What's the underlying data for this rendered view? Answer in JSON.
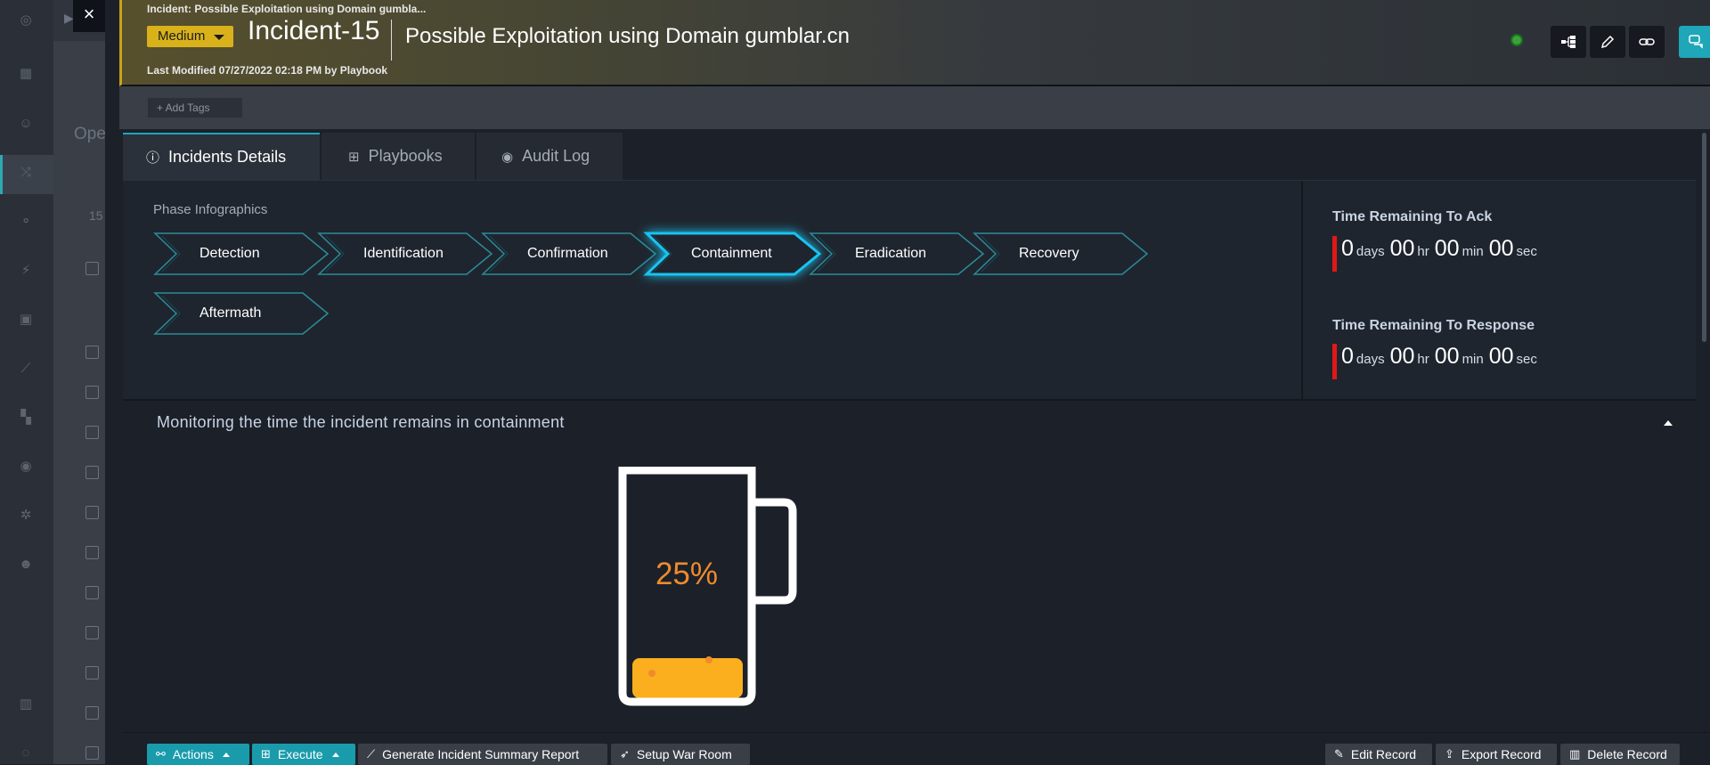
{
  "header": {
    "breadcrumb": "Incident: Possible Exploitation using Domain gumbla...",
    "severity": "Medium",
    "incident_id": "Incident-15",
    "incident_title": "Possible Exploitation using Domain gumblar.cn",
    "last_modified": "Last Modified 07/27/2022 02:18 PM by Playbook"
  },
  "background": {
    "partial_text": "Ope",
    "partial_num": "15"
  },
  "close_label": "×",
  "tags": {
    "add_label": "+ Add Tags"
  },
  "tabs": [
    {
      "label": "Incidents Details",
      "icon": "info-icon",
      "active": true
    },
    {
      "label": "Playbooks",
      "icon": "playbook-icon",
      "active": false
    },
    {
      "label": "Audit Log",
      "icon": "eye-icon",
      "active": false
    }
  ],
  "phase_infographics": {
    "label": "Phase Infographics",
    "phases": [
      "Detection",
      "Identification",
      "Confirmation",
      "Containment",
      "Eradication",
      "Recovery",
      "Aftermath"
    ],
    "current": "Containment"
  },
  "timers": {
    "ack": {
      "label": "Time Remaining To Ack",
      "days": "0",
      "hr": "00",
      "min": "00",
      "sec": "00"
    },
    "response": {
      "label": "Time Remaining To Response",
      "days": "0",
      "hr": "00",
      "min": "00",
      "sec": "00"
    },
    "units": {
      "days": "days",
      "hr": "hr",
      "min": "min",
      "sec": "sec"
    }
  },
  "monitor": {
    "title": "Monitoring the time the incident remains in containment",
    "percent_label": "25%",
    "fill_fraction": 0.25,
    "fill_color": "#fbae1e",
    "text_color": "#ef8b2d"
  },
  "footer": {
    "actions": "Actions",
    "execute": "Execute",
    "summary_report": "Generate Incident Summary Report",
    "war_room": "Setup War Room",
    "edit": "Edit Record",
    "export": "Export Record",
    "delete": "Delete Record"
  },
  "colors": {
    "accent": "#1fa6b8",
    "severity": "#d9b21b",
    "timer_bar": "#e01818",
    "active_phase": "#19c3f0"
  }
}
